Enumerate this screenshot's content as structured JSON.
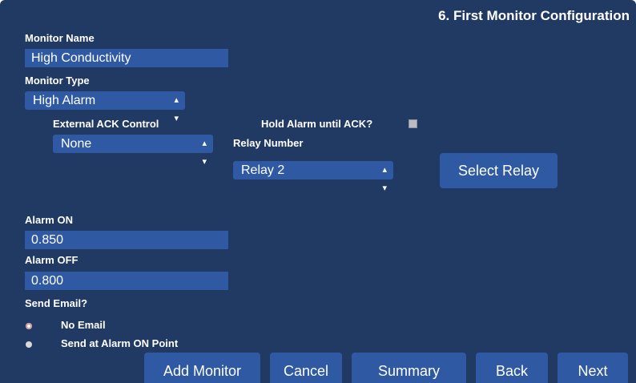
{
  "page": {
    "title": "6. First Monitor Configuration"
  },
  "form": {
    "monitor_name": {
      "label": "Monitor Name",
      "value": "High Conductivity"
    },
    "monitor_type": {
      "label": "Monitor Type",
      "value": "High Alarm",
      "icon": "updown-icon"
    },
    "external_ack": {
      "label": "External ACK Control",
      "value": "None",
      "icon": "updown-icon"
    },
    "hold_alarm": {
      "label": "Hold Alarm until ACK?",
      "checked": false
    },
    "relay": {
      "label": "Relay Number",
      "value": "Relay 2",
      "icon": "updown-icon",
      "button_label": "Select Relay"
    },
    "alarm_on": {
      "label": "Alarm ON",
      "value": "0.850"
    },
    "alarm_off": {
      "label": "Alarm OFF",
      "value": "0.800"
    },
    "send_email": {
      "label": "Send Email?",
      "options": [
        {
          "label": "No Email",
          "selected": true
        },
        {
          "label": "Send at Alarm ON Point",
          "selected": false
        }
      ]
    }
  },
  "footer": {
    "buttons": [
      "Add Monitor",
      "Cancel",
      "Summary",
      "Back",
      "Next"
    ]
  },
  "colors": {
    "panel_background": "#213a63",
    "field_background": "#2f59a3",
    "text": "#ffffff"
  }
}
